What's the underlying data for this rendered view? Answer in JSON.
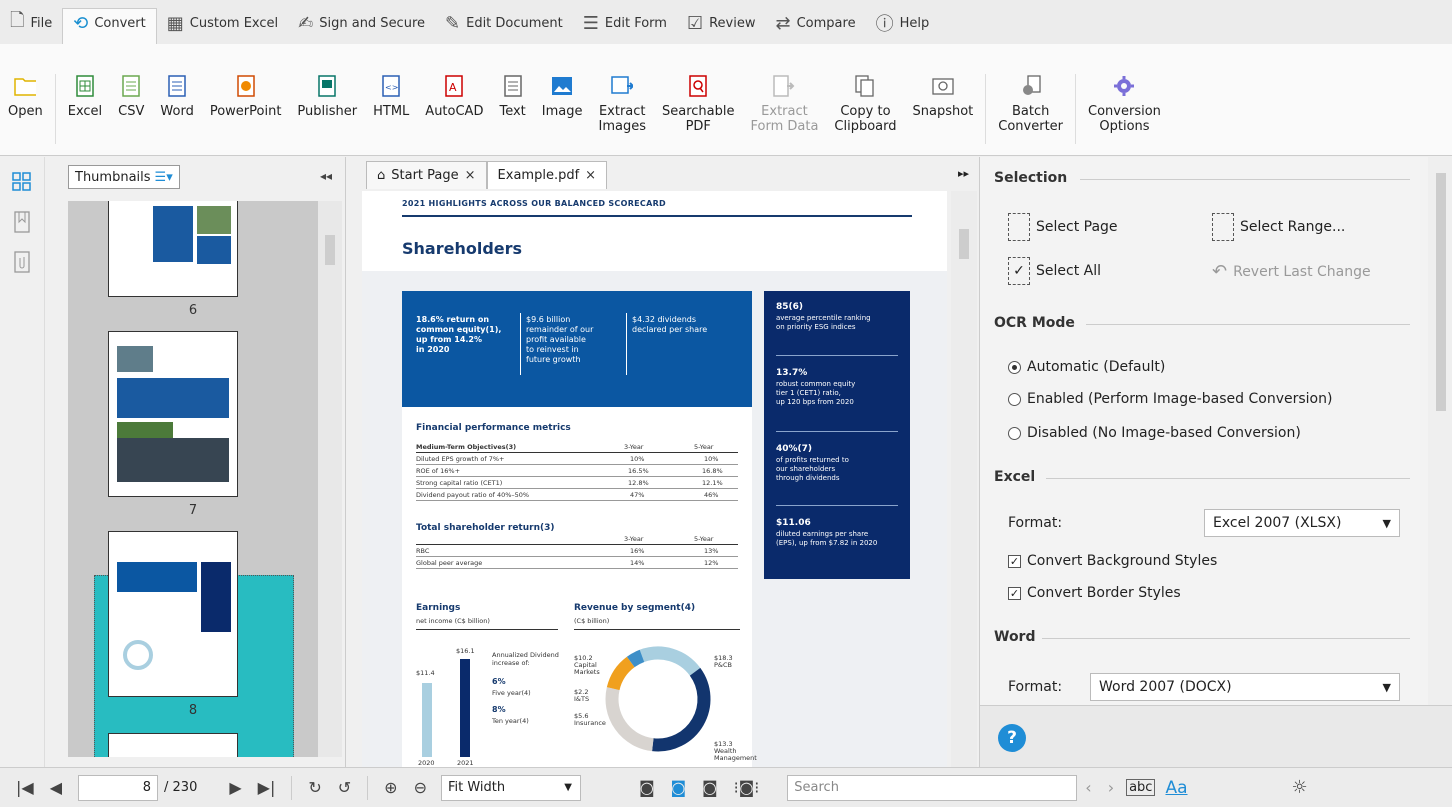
{
  "menu": {
    "tabs": [
      {
        "label": "File",
        "icon": "file-icon"
      },
      {
        "label": "Convert",
        "icon": "convert-icon",
        "active": true
      },
      {
        "label": "Custom Excel",
        "icon": "grid-icon"
      },
      {
        "label": "Sign and Secure",
        "icon": "signature-icon"
      },
      {
        "label": "Edit Document",
        "icon": "edit-document-icon"
      },
      {
        "label": "Edit Form",
        "icon": "form-icon"
      },
      {
        "label": "Review",
        "icon": "review-icon"
      },
      {
        "label": "Compare",
        "icon": "compare-icon"
      },
      {
        "label": "Help",
        "icon": "help-icon"
      }
    ]
  },
  "ribbon": {
    "open": "Open",
    "excel": "Excel",
    "csv": "CSV",
    "word": "Word",
    "powerpoint": "PowerPoint",
    "publisher": "Publisher",
    "html": "HTML",
    "autocad": "AutoCAD",
    "text": "Text",
    "image": "Image",
    "extract_images": "Extract\nImages",
    "searchable_pdf": "Searchable\nPDF",
    "extract_form_data": "Extract\nForm Data",
    "copy_clipboard": "Copy to\nClipboard",
    "snapshot": "Snapshot",
    "batch_converter": "Batch\nConverter",
    "conversion_options": "Conversion\nOptions"
  },
  "thumbnails": {
    "dropdown_label": "Thumbnails",
    "pages": [
      "6",
      "7",
      "8"
    ],
    "selected_page": "8"
  },
  "doc_tabs": {
    "start_page": "Start Page",
    "example": "Example.pdf",
    "close": "×"
  },
  "document": {
    "header": "2021 HIGHLIGHTS ACROSS OUR BALANCED SCORECARD",
    "title": "Shareholders",
    "blue_cols": [
      "18.6% return on\ncommon equity(1),\nup from 14.2%\nin 2020",
      "$9.6 billion\nremainder of our\nprofit available\nto reinvest in\nfuture growth",
      "$4.32 dividends\ndeclared per share"
    ],
    "navy_stats": [
      {
        "value": "85(6)",
        "text": "average percentile ranking\non priority ESG indices"
      },
      {
        "value": "13.7%",
        "text": "robust common equity\ntier 1 (CET1) ratio,\nup 120 bps from 2020"
      },
      {
        "value": "40%(7)",
        "text": "of profits returned to\nour shareholders\nthrough dividends"
      },
      {
        "value": "$11.06",
        "text": "diluted earnings per share\n(EPS), up from $7.82 in 2020"
      }
    ],
    "fin_title": "Financial performance metrics",
    "fin_header": [
      "Medium-Term Objectives(3)",
      "3-Year",
      "5-Year"
    ],
    "fin_rows": [
      [
        "Diluted EPS growth of 7%+",
        "10%",
        "10%"
      ],
      [
        "ROE of 16%+",
        "16.5%",
        "16.8%"
      ],
      [
        "Strong capital ratio (CET1)",
        "12.8%",
        "12.1%"
      ],
      [
        "Dividend payout ratio of 40%–50%",
        "47%",
        "46%"
      ]
    ],
    "tsr_title": "Total shareholder return(3)",
    "tsr_header": [
      "3-Year",
      "5-Year"
    ],
    "tsr_rows": [
      [
        "RBC",
        "16%",
        "13%"
      ],
      [
        "Global peer average",
        "14%",
        "12%"
      ]
    ],
    "earnings_title": "Earnings",
    "earnings_sub": "net income (C$ billion)",
    "earnings_bars": [
      {
        "year": "2020",
        "value": "$11.4"
      },
      {
        "year": "2021",
        "value": "$16.1"
      }
    ],
    "dividend_note": "Annualized Dividend\nincrease of:",
    "div5": "6%",
    "div5_label": "Five year(4)",
    "div10": "8%",
    "div10_label": "Ten year(4)",
    "revenue_title": "Revenue by segment(4)",
    "revenue_sub": "(C$ billion)",
    "segments": [
      {
        "label": "$10.2\nCapital\nMarkets",
        "value": 10.2,
        "color": "#a9cfe0"
      },
      {
        "label": "$18.3\nP&CB",
        "value": 18.3,
        "color": "#12356e"
      },
      {
        "label": "$13.3\nWealth\nManagement",
        "value": 13.3,
        "color": "#d8d4d0"
      },
      {
        "label": "$5.6\nInsurance",
        "value": 5.6,
        "color": "#f0a01e"
      },
      {
        "label": "$2.2\nI&TS",
        "value": 2.2,
        "color": "#3e8fc8"
      }
    ]
  },
  "options": {
    "selection": "Selection",
    "select_page": "Select Page",
    "select_range": "Select Range...",
    "select_all": "Select All",
    "revert": "Revert Last Change",
    "ocr_mode": "OCR Mode",
    "ocr_auto": "Automatic (Default)",
    "ocr_enabled": "Enabled (Perform Image-based Conversion)",
    "ocr_disabled": "Disabled (No Image-based Conversion)",
    "excel": "Excel",
    "format_label": "Format:",
    "excel_format": "Excel 2007 (XLSX)",
    "convert_bg": "Convert Background Styles",
    "convert_border": "Convert Border Styles",
    "word": "Word",
    "word_format": "Word 2007 (DOCX)"
  },
  "status": {
    "current_page": "8",
    "total_pages": "/ 230",
    "zoom": "Fit Width",
    "search_placeholder": "Search",
    "abc": "abc",
    "aa": "Aa"
  },
  "colors": {
    "accent": "#1f8dd6",
    "thumb_selected": "#28bcc1",
    "doc_blue": "#0b57a2",
    "doc_navy": "#0a2a6b"
  }
}
